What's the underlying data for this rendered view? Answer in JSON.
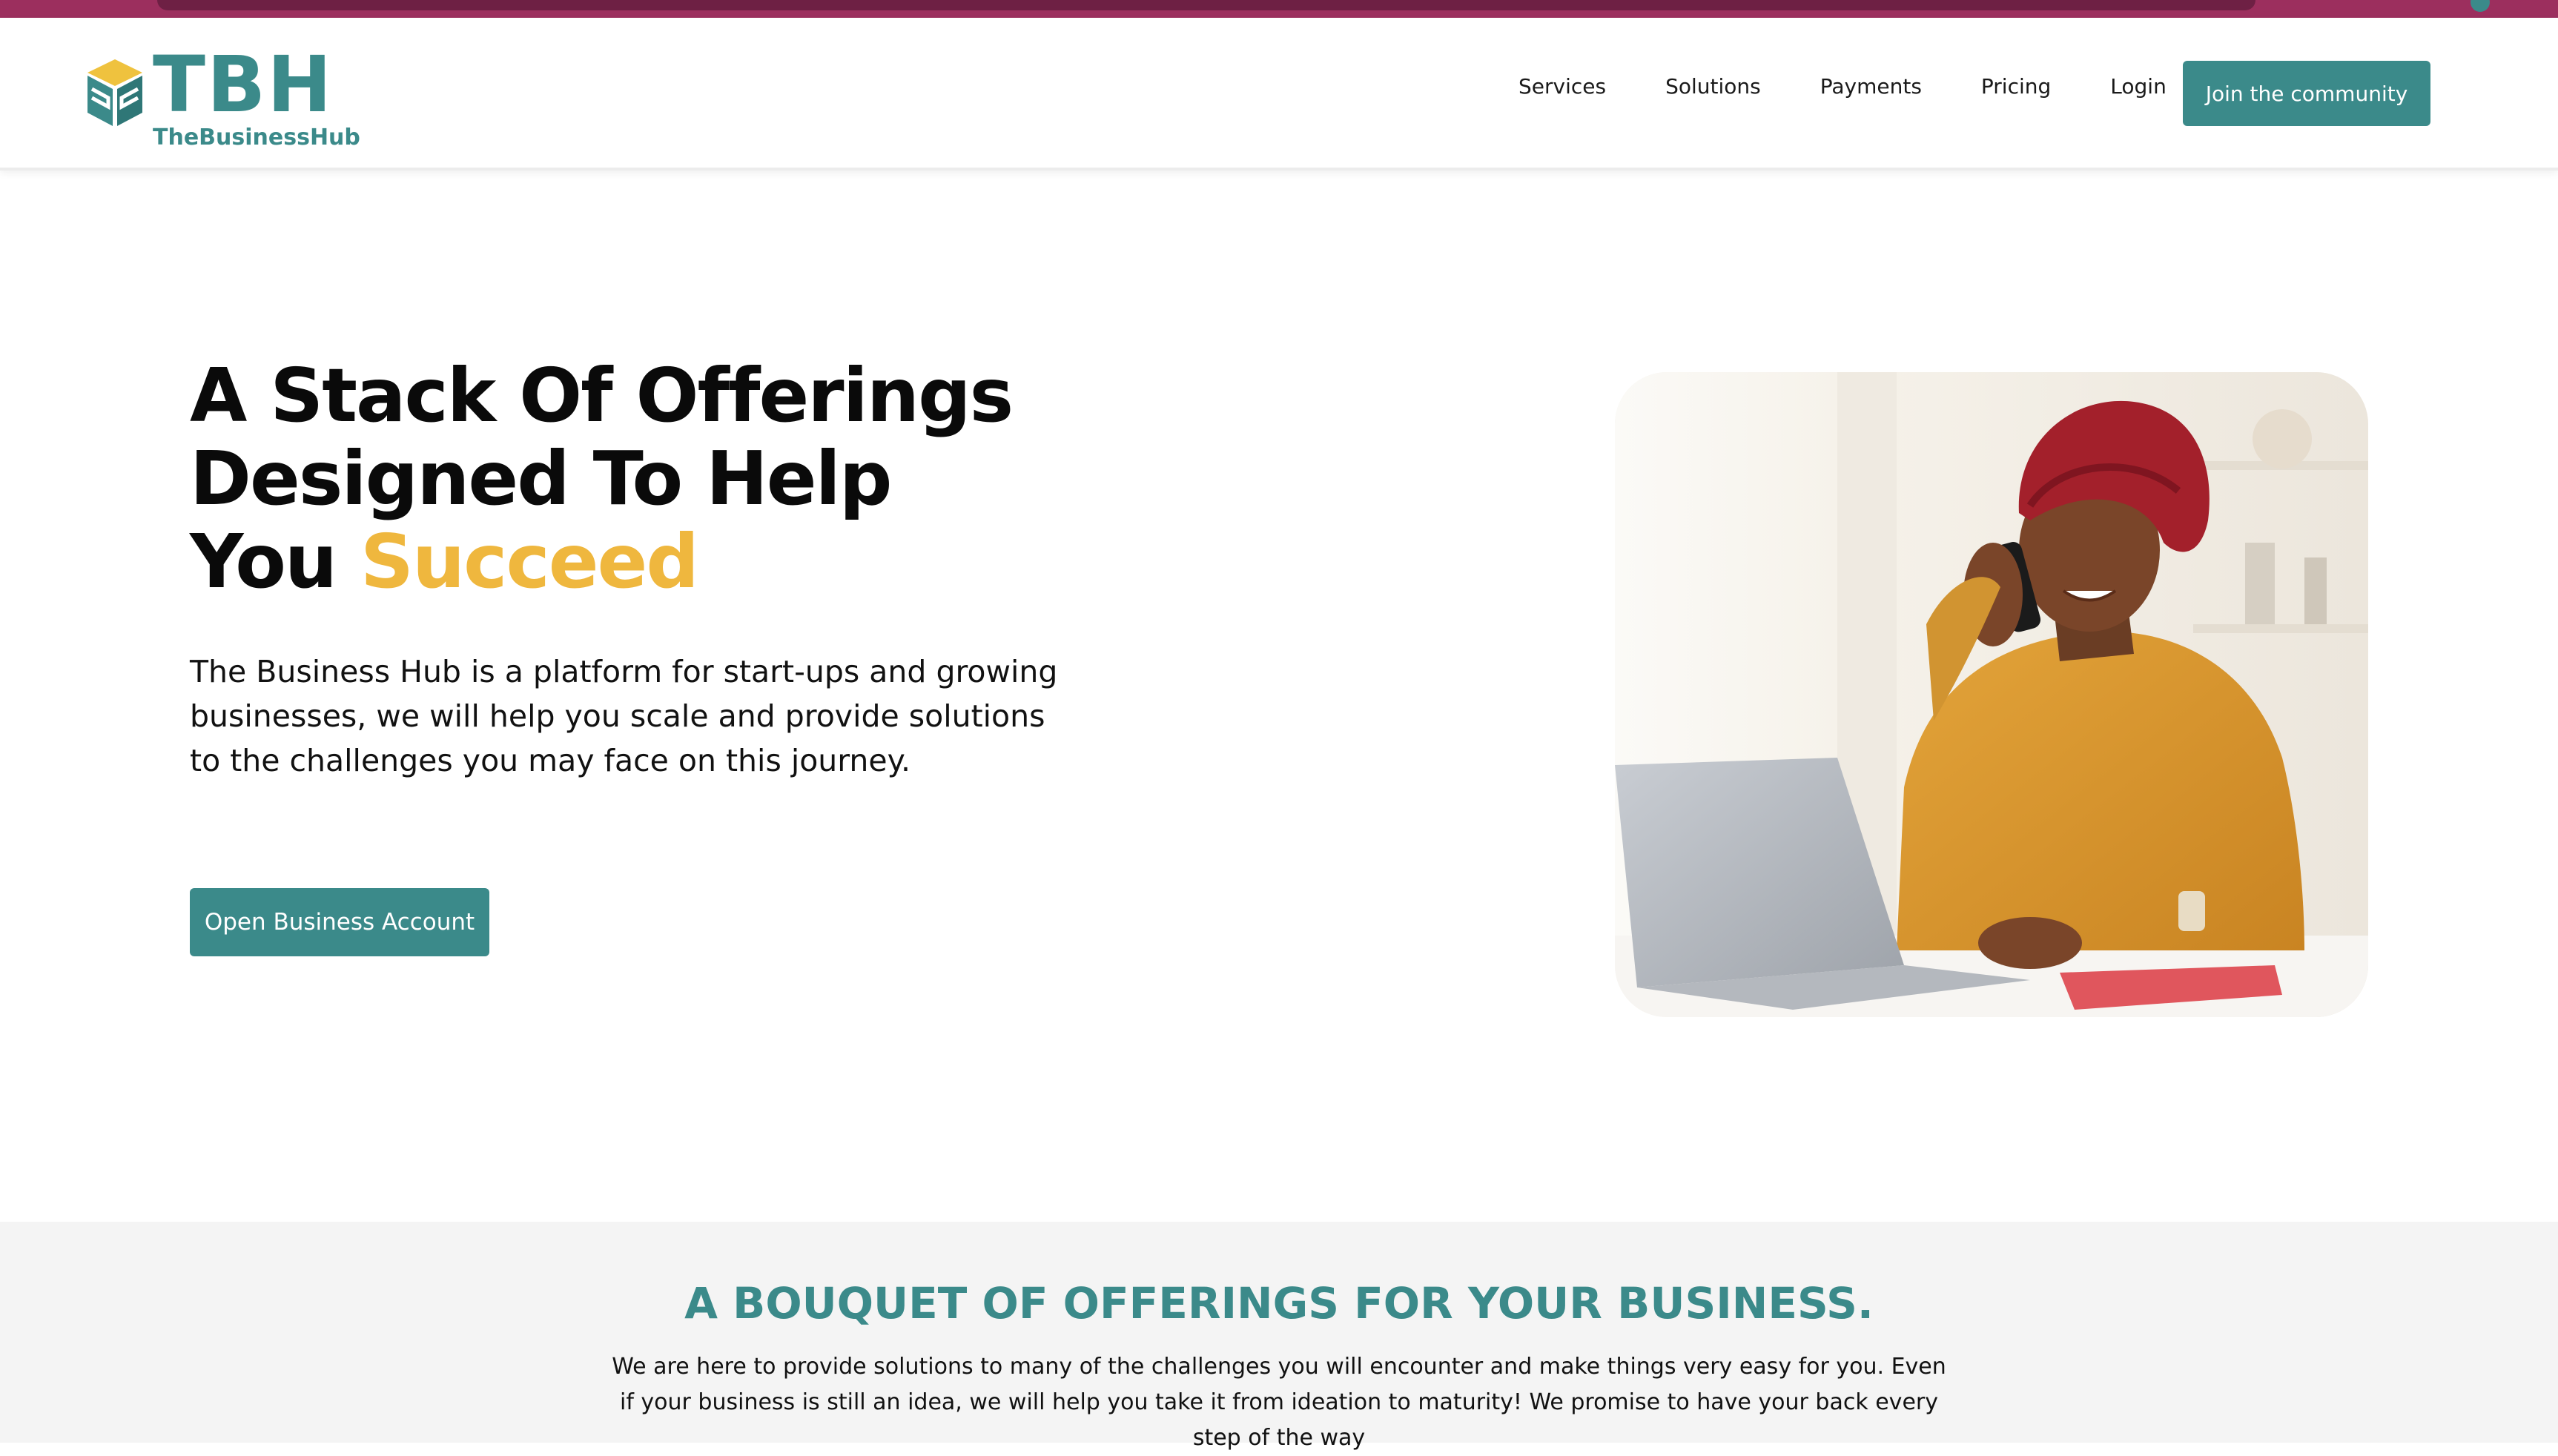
{
  "brand": {
    "mark": "TBH",
    "name": "TheBusinessHub",
    "primary_color": "#3b8a8a",
    "accent_color": "#efb73e",
    "strip_color": "#9c2f5e"
  },
  "nav": {
    "items": [
      {
        "label": "Services"
      },
      {
        "label": "Solutions"
      },
      {
        "label": "Payments"
      },
      {
        "label": "Pricing"
      },
      {
        "label": "Login"
      }
    ],
    "cta_label": "Join the community"
  },
  "hero": {
    "title_line1": "A Stack Of Offerings",
    "title_line2": "Designed To Help",
    "title_line3_prefix": "You ",
    "title_line3_accent": "Succeed",
    "description": "The Business Hub is a platform for start-ups and growing businesses, we will help you scale and provide solutions to the challenges you may face on this journey.",
    "cta_label": "Open Business Account",
    "image_icon": "woman-on-phone-with-laptop-photo"
  },
  "offerings": {
    "title": "A BOUQUET OF OFFERINGS FOR YOUR BUSINESS.",
    "description": "We are here to provide solutions to many of the challenges you will encounter and make things very easy for you. Even if your business is still an idea, we will help you take it from ideation to maturity! We promise to have your back every step of the way"
  }
}
